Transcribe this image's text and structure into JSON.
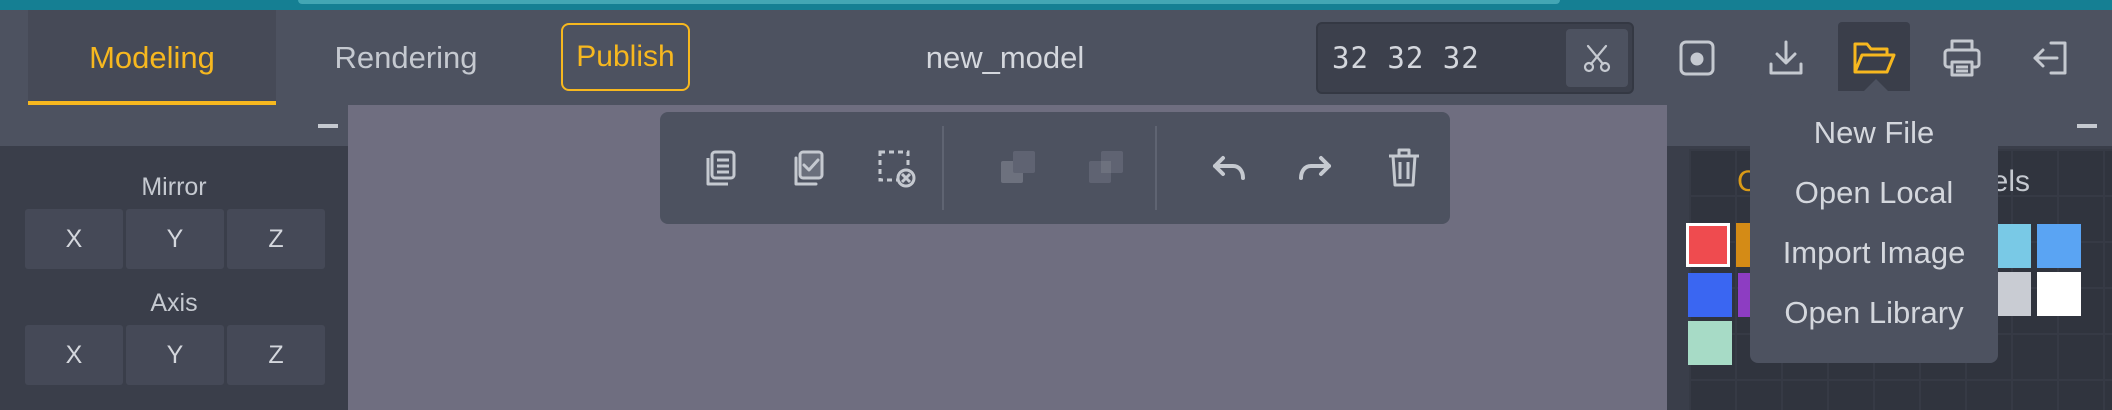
{
  "header": {
    "tabs": [
      {
        "label": "Modeling",
        "active": true
      },
      {
        "label": "Rendering",
        "active": false
      }
    ],
    "publish_label": "Publish",
    "model_name": "new_model",
    "dimensions": "32 32 32",
    "icons": [
      "scissors-icon",
      "save-icon",
      "download-icon",
      "folder-open-icon",
      "print-icon",
      "exit-icon"
    ]
  },
  "left_panel": {
    "mirror_label": "Mirror",
    "axis_label": "Axis",
    "mirror_buttons": [
      "X",
      "Y",
      "Z"
    ],
    "axis_buttons": [
      "X",
      "Y",
      "Z"
    ]
  },
  "toolbar": {
    "icons": [
      "copy-icon",
      "paste-icon",
      "deselect-icon",
      "duplicate-icon",
      "flatten-icon",
      "undo-icon",
      "redo-icon",
      "trash-icon"
    ],
    "disabled": [
      "duplicate-icon",
      "flatten-icon"
    ]
  },
  "right_panel": {
    "tab_left_partial": "C",
    "tab_right_partial": "lels",
    "swatches": [
      "#ef4b4f",
      "#d48b16",
      "#79c9e6",
      "#5aa4f3",
      "#3a66f2",
      "#8d3dc2",
      "#c9ccd3",
      "#ffffff",
      "#a7dbc6"
    ]
  },
  "open_menu": {
    "items": [
      "New File",
      "Open Local",
      "Import Image",
      "Open Library"
    ]
  },
  "colors": {
    "accent": "#f7b81f",
    "header_bg": "#4d5260",
    "panel_bg": "#3a3e4a",
    "viewport_bg": "#6f6e80",
    "scrollbar_strip": "#157f93"
  }
}
